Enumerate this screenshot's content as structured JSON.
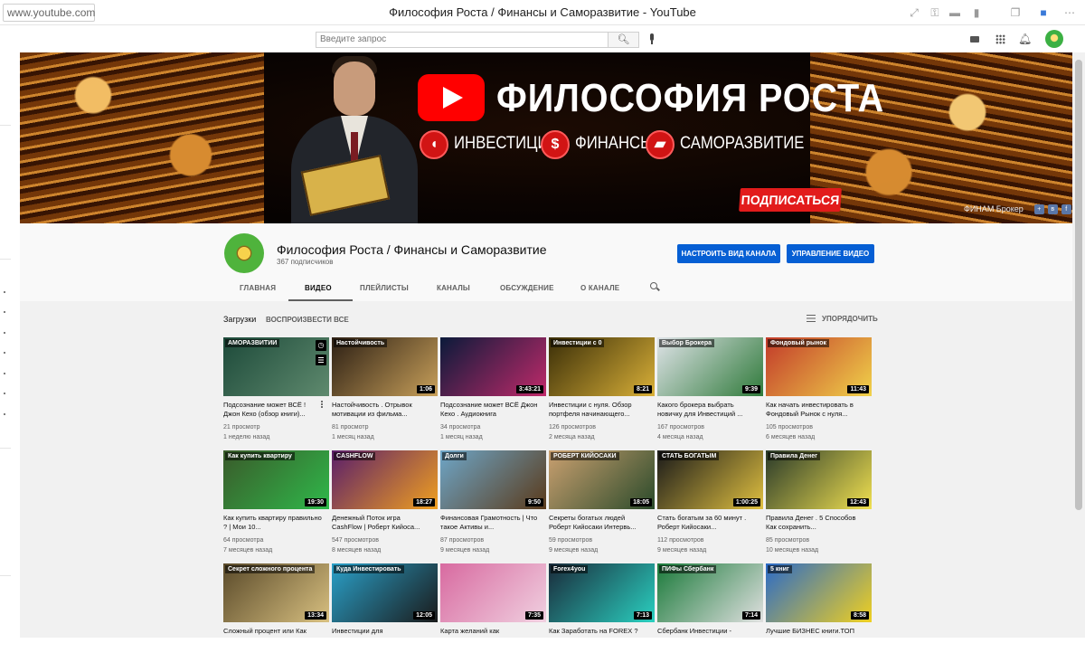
{
  "browser": {
    "url": "www.youtube.com",
    "title": "Философия Роста / Финансы и Саморазвитие - YouTube"
  },
  "header": {
    "search_placeholder": "Введите запрос"
  },
  "banner": {
    "title": "ФИЛОСОФИЯ РОСТА",
    "tag_investments": "ИНВЕСТИЦИИ",
    "tag_finance": "ФИНАНСЫ",
    "tag_selfdev": "САМОРАЗВИТИЕ",
    "finance_glyph": "$",
    "subscribe_label": "ПОДПИСАТЬСЯ",
    "link_label": "ФИНАМ Брокер"
  },
  "channel": {
    "name": "Философия Роста / Финансы и Саморазвитие",
    "subscribers": "367 подписчиков",
    "customize_label": "НАСТРОИТЬ ВИД КАНАЛА",
    "manage_label": "УПРАВЛЕНИЕ ВИДЕО"
  },
  "tabs": [
    "ГЛАВНАЯ",
    "ВИДЕО",
    "ПЛЕЙЛИСТЫ",
    "КАНАЛЫ",
    "ОБСУЖДЕНИЕ",
    "О КАНАЛЕ"
  ],
  "active_tab_index": 1,
  "section": {
    "title": "Загрузки",
    "play_all": "ВОСПРОИЗВЕСТИ ВСЕ",
    "sort_label": "УПОРЯДОЧИТЬ"
  },
  "videos": [
    {
      "title": "Подсознание может ВСЁ ! Джон Кехо (обзор книги)...",
      "views": "21 просмотр",
      "age": "1 неделю назад",
      "duration": "",
      "thumb_text": "АМОРАЗВИТИИ",
      "colors": [
        "#1d4a3a",
        "#5f8a6e"
      ]
    },
    {
      "title": "Настойчивость . Отрывок мотивации из фильма...",
      "views": "81 просмотр",
      "age": "1 месяц назад",
      "duration": "1:06",
      "thumb_text": "Настойчивость",
      "colors": [
        "#2c1f14",
        "#c8a05a"
      ]
    },
    {
      "title": "Подсознание может ВСЁ Джон Кехо . Аудиокнига",
      "views": "34 просмотра",
      "age": "1 месяц назад",
      "duration": "3:43:21",
      "thumb_text": "",
      "colors": [
        "#0b1a3a",
        "#c02a6a"
      ]
    },
    {
      "title": "Инвестиции с нуля. Обзор портфеля начинающего...",
      "views": "126 просмотров",
      "age": "2 месяца назад",
      "duration": "8:21",
      "thumb_text": "Инвестиции с 0",
      "colors": [
        "#3a2e08",
        "#d9b038"
      ]
    },
    {
      "title": "Какого брокера выбрать новичку для Инвестиций ...",
      "views": "167 просмотров",
      "age": "4 месяца назад",
      "duration": "9:39",
      "thumb_text": "Выбор Брокера",
      "colors": [
        "#dfe3e8",
        "#2f7a3a"
      ]
    },
    {
      "title": "Как начать инвестировать в Фондовый Рынок с нуля...",
      "views": "105 просмотров",
      "age": "6 месяцев назад",
      "duration": "11:43",
      "thumb_text": "Фондовый рынок",
      "colors": [
        "#c23a2a",
        "#f0d24a"
      ]
    },
    {
      "title": "Как купить квартиру правильно ? | Мои 10...",
      "views": "64 просмотра",
      "age": "7 месяцев назад",
      "duration": "19:30",
      "thumb_text": "Как купить квартиру",
      "colors": [
        "#3a5a2a",
        "#2fb84a"
      ]
    },
    {
      "title": "Денежный Поток игра CashFlow | Роберт Кийоса...",
      "views": "547 просмотров",
      "age": "8 месяцев назад",
      "duration": "18:27",
      "thumb_text": "CASHFLOW",
      "colors": [
        "#5a1e6a",
        "#f0a020"
      ]
    },
    {
      "title": "Финансовая Грамотность | Что такое Активы и...",
      "views": "87 просмотров",
      "age": "9 месяцев назад",
      "duration": "9:50",
      "thumb_text": "Долги",
      "colors": [
        "#6ea6c8",
        "#5a3a1a"
      ]
    },
    {
      "title": "Секреты богатых людей Роберт Кийосаки Интервь...",
      "views": "59 просмотров",
      "age": "9 месяцев назад",
      "duration": "18:05",
      "thumb_text": "РОБЕРТ КИЙОСАКИ",
      "colors": [
        "#caa070",
        "#2a4a2a"
      ]
    },
    {
      "title": "Стать богатым за 60 минут . Роберт Кийосаки...",
      "views": "112 просмотров",
      "age": "9 месяцев назад",
      "duration": "1:00:25",
      "thumb_text": "СТАТЬ БОГАТЫМ",
      "colors": [
        "#1a1a1a",
        "#e0c040"
      ]
    },
    {
      "title": "Правила Денег . 5 Способов Как сохранить...",
      "views": "85 просмотров",
      "age": "10 месяцев назад",
      "duration": "12:43",
      "thumb_text": "Правила Денег",
      "colors": [
        "#2a3a2a",
        "#f0e050"
      ]
    },
    {
      "title": "Сложный процент или Как",
      "views": "",
      "age": "",
      "duration": "13:34",
      "thumb_text": "Секрет сложного процента",
      "colors": [
        "#5a4a2a",
        "#d8c080"
      ]
    },
    {
      "title": "Инвестиции для",
      "views": "",
      "age": "",
      "duration": "12:05",
      "thumb_text": "Куда Инвестировать",
      "colors": [
        "#2aa0c8",
        "#1a1a1a"
      ]
    },
    {
      "title": "Карта желаний как",
      "views": "",
      "age": "",
      "duration": "7:35",
      "thumb_text": "",
      "colors": [
        "#d86aa0",
        "#f0d0e0"
      ]
    },
    {
      "title": "Как Заработать на FOREX ?",
      "views": "",
      "age": "",
      "duration": "7:13",
      "thumb_text": "Forex4you",
      "colors": [
        "#1a2a3a",
        "#2ad0c0"
      ]
    },
    {
      "title": "Сбербанк Инвестиции -",
      "views": "",
      "age": "",
      "duration": "7:14",
      "thumb_text": "ПИФы Сбербанк",
      "colors": [
        "#1a7a3a",
        "#e0e0e0"
      ]
    },
    {
      "title": "Лучшие БИЗНЕС книги.ТОП",
      "views": "",
      "age": "",
      "duration": "8:58",
      "thumb_text": "5 книг",
      "colors": [
        "#2a6ac8",
        "#f0d020"
      ]
    }
  ]
}
